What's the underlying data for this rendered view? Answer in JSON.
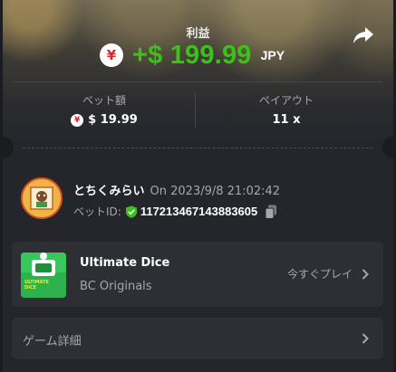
{
  "header": {
    "profit_label": "利益",
    "profit_amount": "+$ 199.99",
    "currency": "JPY",
    "currency_icon": "yen-coin-icon"
  },
  "stats": {
    "bet_label": "ベット額",
    "bet_value": "$ 19.99",
    "payout_label": "ペイアウト",
    "payout_value": "11 x"
  },
  "user": {
    "name": "とちくみらい",
    "date": "On 2023/9/8 21:02:42",
    "bet_id_label": "ベットID:",
    "bet_id": "117213467143883605"
  },
  "game": {
    "title": "Ultimate Dice",
    "provider": "BC Originals",
    "play_label": "今すぐプレイ",
    "thumb_text_1": "ULTIMATE",
    "thumb_text_2": "DICE"
  },
  "details": {
    "label": "ゲーム詳細"
  },
  "colors": {
    "profit_green": "#3bc117",
    "background": "#24262b",
    "muted_text": "#a5a7ad",
    "yen_red": "#e0242d"
  }
}
